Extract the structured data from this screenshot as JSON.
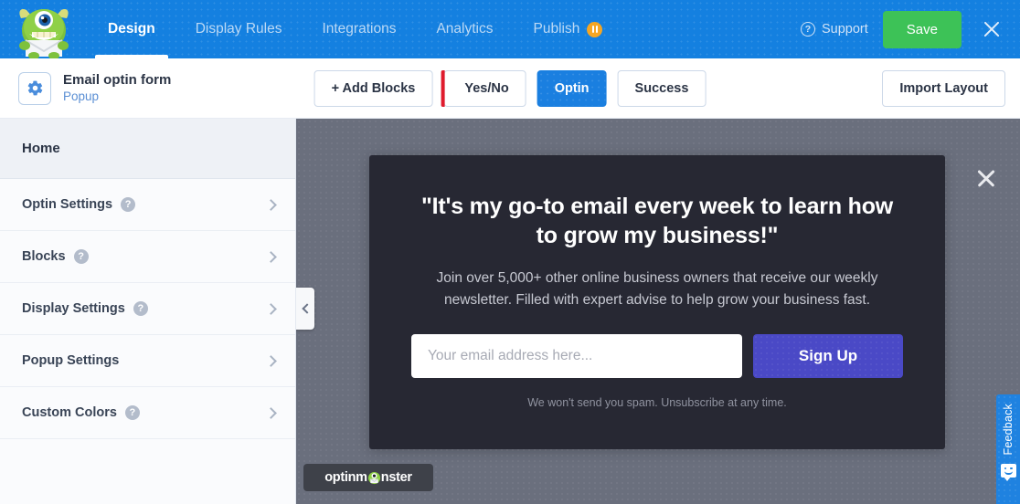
{
  "header": {
    "logo_alt": "optinmonster-mascot",
    "tabs": [
      {
        "label": "Design",
        "active": true,
        "badge": null
      },
      {
        "label": "Display Rules",
        "active": false,
        "badge": null
      },
      {
        "label": "Integrations",
        "active": false,
        "badge": null
      },
      {
        "label": "Analytics",
        "active": false,
        "badge": null
      },
      {
        "label": "Publish",
        "active": false,
        "badge": "pause"
      }
    ],
    "support_label": "Support",
    "support_icon_char": "?",
    "save_label": "Save",
    "close_icon": "close-icon",
    "bg_color": "#1480e0",
    "save_color": "#3dc257",
    "badge_color": "#f5a623"
  },
  "toolbar": {
    "gear_icon": "gear-icon",
    "campaign_title": "Email optin form",
    "campaign_type": "Popup",
    "add_blocks_label": "+ Add Blocks",
    "view_tabs": [
      {
        "label": "Yes/No",
        "active": false,
        "accent": "#e01b2d"
      },
      {
        "label": "Optin",
        "active": true,
        "accent": null
      },
      {
        "label": "Success",
        "active": false,
        "accent": null
      }
    ],
    "import_layout_label": "Import Layout"
  },
  "sidebar": {
    "home_label": "Home",
    "items": [
      {
        "label": "Optin Settings",
        "help": true
      },
      {
        "label": "Blocks",
        "help": true
      },
      {
        "label": "Display Settings",
        "help": true
      },
      {
        "label": "Popup Settings",
        "help": false
      },
      {
        "label": "Custom Colors",
        "help": true
      }
    ],
    "help_char": "?"
  },
  "canvas": {
    "bg_color": "#6a6f7d",
    "collapse_icon": "chevron-left-icon",
    "popup": {
      "bg_color": "#272833",
      "close_icon": "close-icon",
      "headline": "\"It's my go-to email every week to learn how to grow my business!\"",
      "subheadline": "Join over 5,000+ other online business owners that receive our weekly newsletter. Filled with expert advise to help grow your business fast.",
      "email_placeholder": "Your email address here...",
      "email_value": "",
      "signup_label": "Sign Up",
      "signup_color": "#4a49c6",
      "fine_print": "We won't send you spam. Unsubscribe at any time."
    },
    "badge": {
      "text_before": "optinm",
      "text_after": "nster",
      "icon": "monster-icon"
    }
  },
  "feedback": {
    "label": "Feedback",
    "icon": "smiley-speech-bubble-icon",
    "color": "#1f82e0"
  }
}
